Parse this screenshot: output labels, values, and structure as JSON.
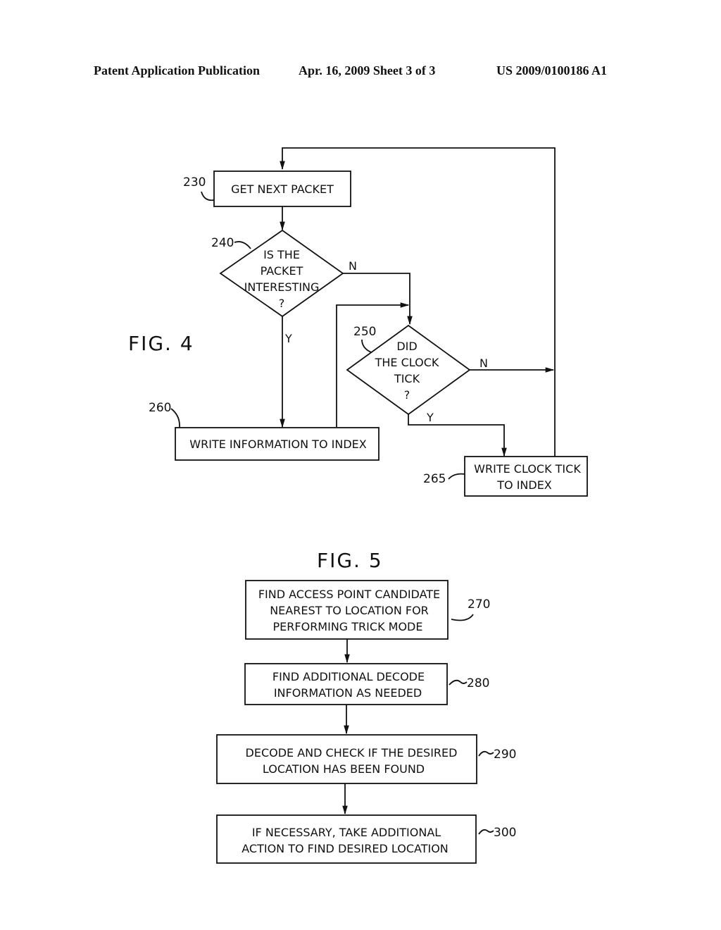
{
  "header": {
    "left": "Patent Application Publication",
    "center": "Apr. 16, 2009  Sheet 3 of 3",
    "right": "US 2009/0100186 A1"
  },
  "fig4": {
    "title": "FIG. 4",
    "nodes": {
      "n230": {
        "ref": "230",
        "lines": [
          "GET NEXT PACKET"
        ]
      },
      "n240": {
        "ref": "240",
        "lines": [
          "IS THE",
          "PACKET",
          "INTERESTING",
          "?"
        ]
      },
      "n250": {
        "ref": "250",
        "lines": [
          "DID",
          "THE CLOCK",
          "TICK",
          "?"
        ]
      },
      "n260": {
        "ref": "260",
        "lines": [
          "WRITE INFORMATION TO INDEX"
        ]
      },
      "n265": {
        "ref": "265",
        "lines": [
          "WRITE CLOCK TICK",
          "TO INDEX"
        ]
      }
    },
    "edge_labels": {
      "n240_no": "N",
      "n240_yes": "Y",
      "n250_no": "N",
      "n250_yes": "Y"
    }
  },
  "fig5": {
    "title": "FIG. 5",
    "steps": [
      {
        "ref": "270",
        "lines": [
          "FIND ACCESS POINT CANDIDATE",
          "NEAREST TO LOCATION FOR",
          "PERFORMING TRICK MODE"
        ]
      },
      {
        "ref": "280",
        "lines": [
          "FIND ADDITIONAL DECODE",
          "INFORMATION AS NEEDED"
        ]
      },
      {
        "ref": "290",
        "lines": [
          "DECODE AND CHECK IF THE DESIRED",
          "LOCATION HAS BEEN FOUND"
        ]
      },
      {
        "ref": "300",
        "lines": [
          "IF NECESSARY, TAKE ADDITIONAL",
          "ACTION TO FIND DESIRED LOCATION"
        ]
      }
    ]
  }
}
